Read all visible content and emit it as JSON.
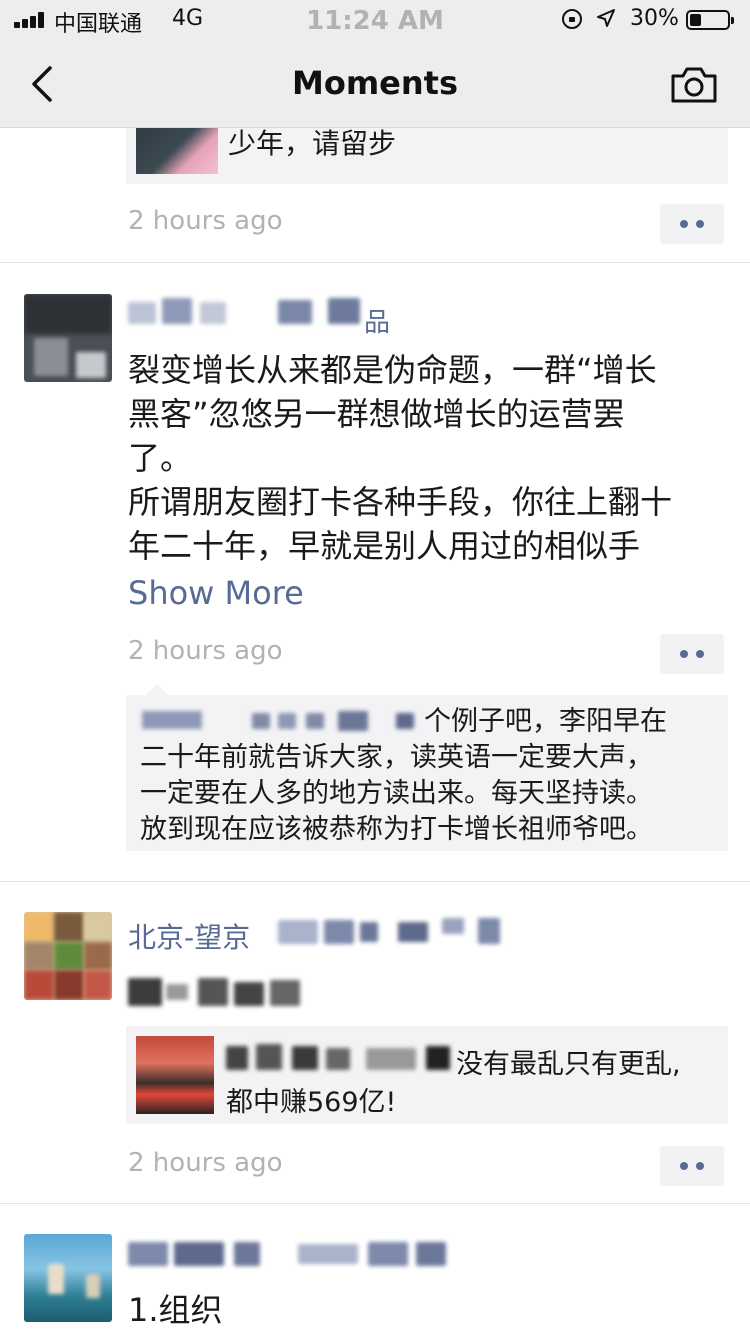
{
  "status_bar": {
    "carrier": "中国联通",
    "network": "4G",
    "time": "11:24 AM",
    "battery_percent": "30%",
    "battery_level": 0.3
  },
  "nav": {
    "title": "Moments",
    "back_icon": "chevron-left-icon",
    "camera_icon": "camera-icon"
  },
  "posts": [
    {
      "shared_title": "少年，请留步",
      "time": "2 hours ago"
    },
    {
      "name_visible_fragment": "品",
      "text_lines": [
        "裂变增长从来都是伪命题，一群“增长",
        "黑客”忽悠另一群想做增长的运营罢",
        "了。",
        "所谓朋友圈打卡各种手段，你往上翻十",
        "年二十年，早就是别人用过的相似手"
      ],
      "show_more": "Show More",
      "time": "2 hours ago",
      "comment_lines": [
        "个例子吧，李阳早在",
        "二十年前就告诉大家，读英语一定要大声，",
        "一定要在人多的地方读出来。每天坚持读。",
        "放到现在应该被恭称为打卡增长祖师爷吧。"
      ]
    },
    {
      "name_visible_fragment": "北京-望京",
      "shared_text_line1": "没有最乱只有更乱,",
      "shared_text_line2": "都中赚569亿!",
      "time": "2 hours ago"
    },
    {
      "text": "1.组织"
    }
  ],
  "colors": {
    "link": "#576b95",
    "time": "#b2b2b2",
    "nav_bg": "#ededed"
  }
}
